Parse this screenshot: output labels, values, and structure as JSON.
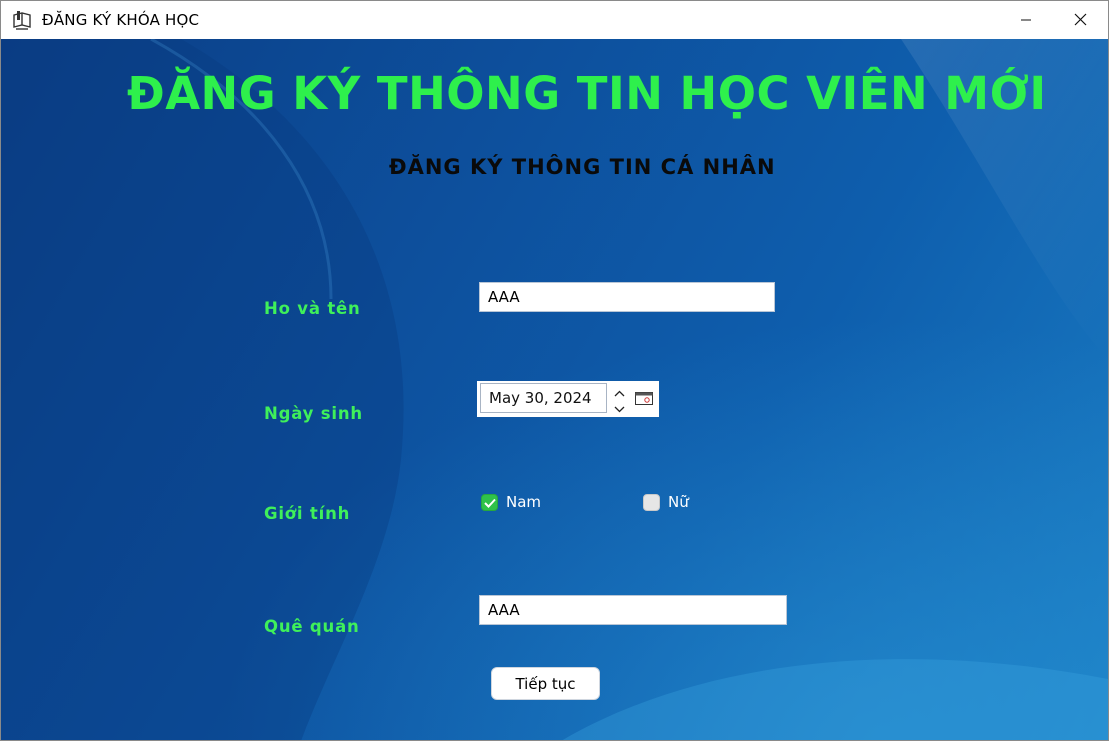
{
  "window": {
    "title": "ĐĂNG KÝ KHÓA HỌC",
    "icon": "book-icon",
    "controls": {
      "minimize_icon": "minimize-icon",
      "close_icon": "close-icon"
    }
  },
  "form": {
    "main_title": "ĐĂNG KÝ THÔNG TIN HỌC VIÊN MỚI",
    "section_title": "ĐĂNG KÝ THÔNG TIN CÁ NHÂN",
    "fields": {
      "full_name": {
        "label": "Ho và tên",
        "value": "AAA"
      },
      "birth_date": {
        "label": "Ngày sinh",
        "value": "May 30, 2024"
      },
      "gender": {
        "label": "Giới tính",
        "options": [
          {
            "label": "Nam",
            "checked": true
          },
          {
            "label": "Nữ",
            "checked": false
          }
        ]
      },
      "hometown": {
        "label": "Quê quán",
        "value": "AAA"
      }
    },
    "next_button": "Tiếp tục"
  },
  "colors": {
    "title_green": "#2ef04c",
    "label_green": "#3ff05a",
    "background_blue": "#0d4f9c",
    "checkbox_green": "#2fc24a"
  }
}
